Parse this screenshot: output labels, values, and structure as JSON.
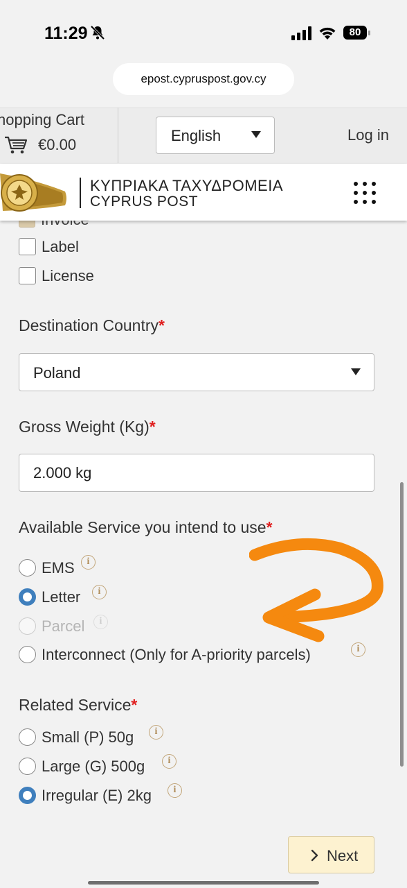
{
  "status_bar": {
    "time": "11:29",
    "battery": "80"
  },
  "browser": {
    "url": "epost.cypruspost.gov.cy"
  },
  "topbar": {
    "cart_title": "hopping Cart",
    "cart_total": "€0.00",
    "language": "English",
    "login": "Log in"
  },
  "header": {
    "greek_name": "ΚΥΠΡΙΑΚΑ ΤΑΧΥΔΡΟΜΕΙΑ",
    "english_name": "CYPRUS POST"
  },
  "documents": {
    "partial_item": "Invoice",
    "items": [
      {
        "label": "Label",
        "checked": false
      },
      {
        "label": "License",
        "checked": false
      }
    ]
  },
  "destination": {
    "label": "Destination Country",
    "required": "*",
    "value": "Poland"
  },
  "weight": {
    "label": "Gross Weight (Kg)",
    "required": "*",
    "value": "2.000 kg"
  },
  "service": {
    "label": "Available Service you intend to use",
    "required": "*",
    "options": [
      {
        "label": "EMS",
        "state": "unchecked"
      },
      {
        "label": "Letter",
        "state": "checked"
      },
      {
        "label": "Parcel",
        "state": "disabled"
      },
      {
        "label": "Interconnect (Only for A-priority parcels)",
        "state": "unchecked"
      }
    ]
  },
  "related": {
    "label": "Related Service",
    "required": "*",
    "options": [
      {
        "label": "Small (P) 50g",
        "state": "unchecked"
      },
      {
        "label": "Large (G) 500g",
        "state": "unchecked"
      },
      {
        "label": "Irregular (E) 2kg",
        "state": "checked"
      }
    ]
  },
  "info_glyph": "i",
  "next_button": "Next",
  "colors": {
    "accent_radio": "#3f7fbd",
    "required_star": "#e02020",
    "annotation_arrow": "#f5890f",
    "next_button_bg": "#fdf2d0"
  }
}
